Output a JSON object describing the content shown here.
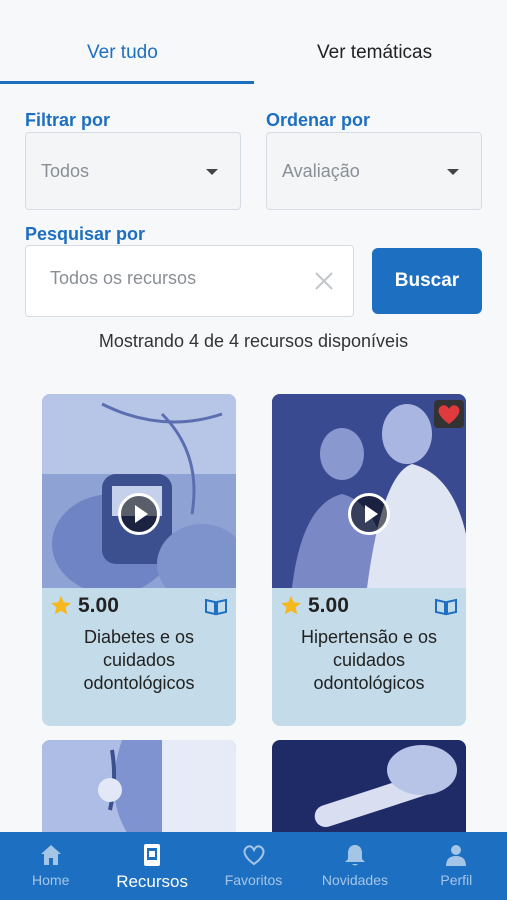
{
  "tabs": {
    "all": "Ver tudo",
    "themes": "Ver temáticas"
  },
  "filters": {
    "filter_label": "Filtrar por",
    "filter_value": "Todos",
    "sort_label": "Ordenar por",
    "sort_value": "Avaliação",
    "search_label": "Pesquisar por",
    "search_placeholder": "Todos os recursos",
    "search_button": "Buscar"
  },
  "results_text": "Mostrando 4 de 4 recursos disponíveis",
  "cards": [
    {
      "rating": "5.00",
      "title": "Diabetes e os cuidados odontológicos"
    },
    {
      "rating": "5.00",
      "title": "Hipertensão e os cuidados odontológicos"
    }
  ],
  "nav": [
    {
      "label": "Home",
      "icon": "home-icon"
    },
    {
      "label": "Recursos",
      "icon": "resources-icon"
    },
    {
      "label": "Favoritos",
      "icon": "heart-icon"
    },
    {
      "label": "Novidades",
      "icon": "bell-icon"
    },
    {
      "label": "Perfil",
      "icon": "user-icon"
    }
  ],
  "colors": {
    "primary": "#1d6fc1",
    "card_bg": "#c4dce9",
    "star": "#f5b820",
    "heart": "#e0393e"
  }
}
